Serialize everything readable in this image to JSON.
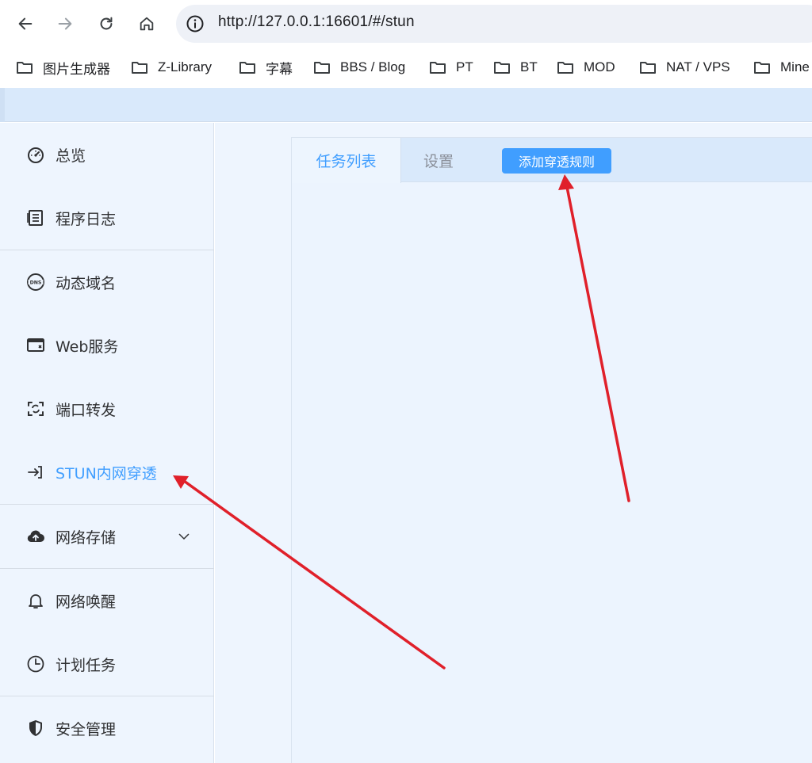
{
  "browser": {
    "url": "http://127.0.0.1:16601/#/stun"
  },
  "bookmarks": [
    {
      "label": "图片生成器"
    },
    {
      "label": "Z-Library"
    },
    {
      "label": "字幕"
    },
    {
      "label": "BBS / Blog"
    },
    {
      "label": "PT"
    },
    {
      "label": "BT"
    },
    {
      "label": "MOD"
    },
    {
      "label": "NAT / VPS"
    },
    {
      "label": "Mine"
    }
  ],
  "sidebar": {
    "items": [
      {
        "label": "总览",
        "icon": "dashboard-icon"
      },
      {
        "label": "程序日志",
        "icon": "log-icon"
      },
      {
        "label": "动态域名",
        "icon": "dns-icon"
      },
      {
        "label": "Web服务",
        "icon": "web-service-icon"
      },
      {
        "label": "端口转发",
        "icon": "port-forward-icon"
      },
      {
        "label": "STUN内网穿透",
        "icon": "stun-icon",
        "active": true
      },
      {
        "label": "网络存储",
        "icon": "cloud-upload-icon",
        "expandable": true
      },
      {
        "label": "网络唤醒",
        "icon": "bell-icon"
      },
      {
        "label": "计划任务",
        "icon": "clock-icon"
      },
      {
        "label": "安全管理",
        "icon": "shield-icon"
      }
    ]
  },
  "main": {
    "tabs": [
      {
        "label": "任务列表",
        "active": true
      },
      {
        "label": "设置"
      }
    ],
    "add_button_label": "添加穿透规则"
  },
  "colors": {
    "accent": "#409eff",
    "annotation_arrow": "#e0202a",
    "header_bg": "#d9e9fb",
    "sidebar_bg": "#eef5fe"
  }
}
